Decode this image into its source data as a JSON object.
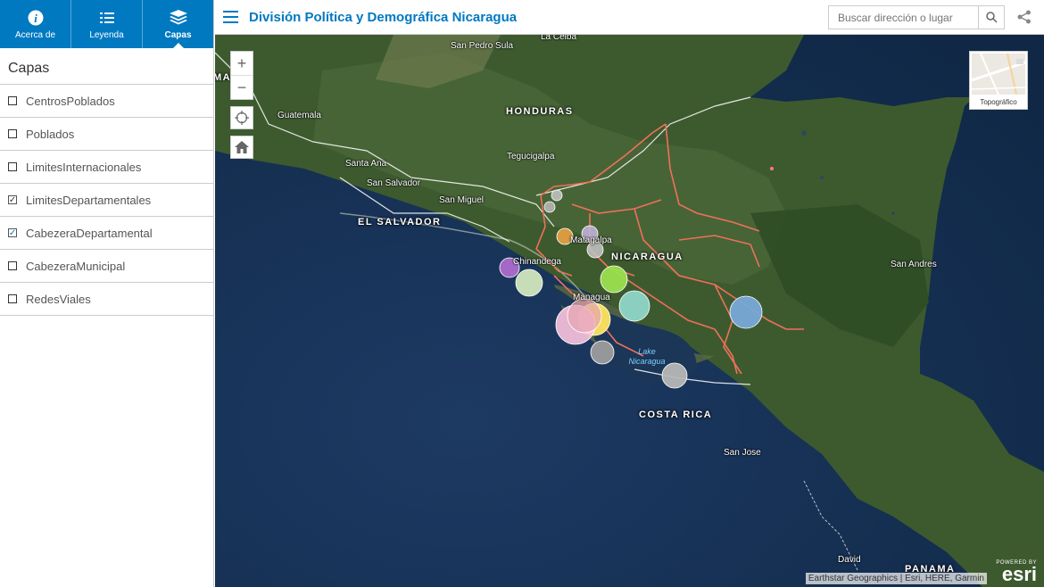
{
  "sidebar": {
    "tabs": [
      {
        "label": "Acerca de",
        "icon": "info-icon"
      },
      {
        "label": "Leyenda",
        "icon": "legend-icon"
      },
      {
        "label": "Capas",
        "icon": "layers-icon"
      }
    ],
    "panel_title": "Capas",
    "layers": [
      {
        "label": "CentrosPoblados",
        "checked": false
      },
      {
        "label": "Poblados",
        "checked": false
      },
      {
        "label": "LimitesInternacionales",
        "checked": false
      },
      {
        "label": "LimitesDepartamentales",
        "checked": true
      },
      {
        "label": "CabezeraDepartamental",
        "checked": true
      },
      {
        "label": "CabezeraMunicipal",
        "checked": false
      },
      {
        "label": "RedesViales",
        "checked": false
      }
    ]
  },
  "header": {
    "title": "División Política y Demográfica Nicaragua",
    "search_placeholder": "Buscar dirección o lugar"
  },
  "map": {
    "zoom_in": "+",
    "zoom_out": "−",
    "basemap_label": "Topográfico",
    "attribution": "Earthstar Geographics | Esri, HERE, Garmin",
    "logo_powered": "POWERED BY",
    "logo_name": "esri",
    "countries": {
      "guatemala": "MALA",
      "honduras": "HONDURAS",
      "el_salvador": "EL SALVADOR",
      "nicaragua": "NICARAGUA",
      "costa_rica": "COSTA RICA",
      "panama": "PANAMA"
    },
    "places": {
      "san_pedro_sula": "San Pedro Sula",
      "la_ceiba": "La Ceiba",
      "guatemala_city": "Guatemala",
      "santa_ana": "Santa Ana",
      "san_salvador": "San Salvador",
      "san_miguel": "San Miguel",
      "tegucigalpa": "Tegucigalpa",
      "matagalpa": "Matagalpa",
      "chinandega": "Chinandega",
      "managua": "Managua",
      "san_andres": "San Andres",
      "san_jose": "San Jose",
      "david": "David"
    },
    "lake_label": "Lake Nicaragua",
    "colors": {
      "accent": "#0079c1",
      "boundary": "#f0705a"
    }
  }
}
